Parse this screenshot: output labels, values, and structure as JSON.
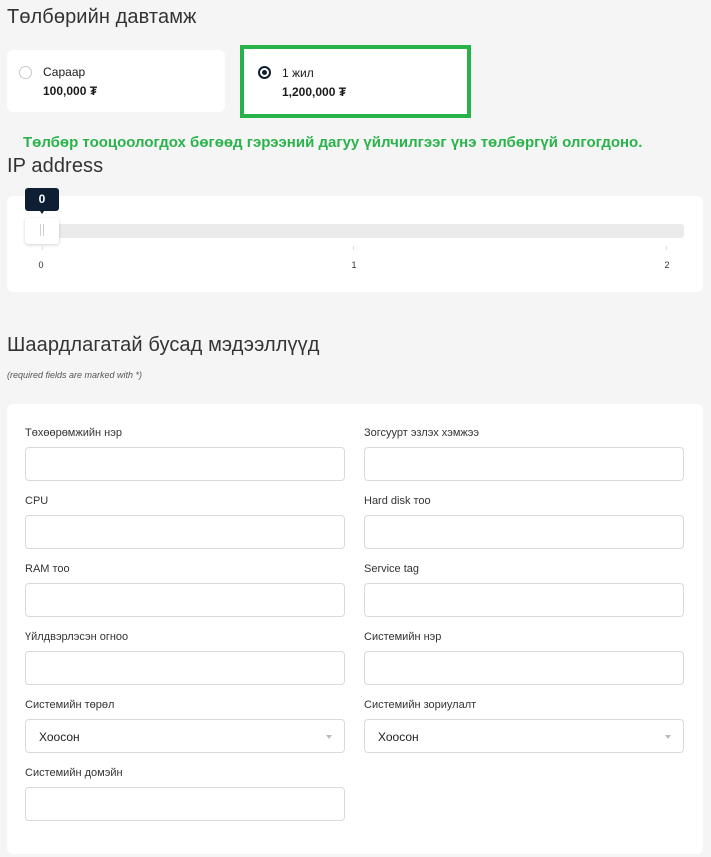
{
  "billing": {
    "title": "Төлбөрийн давтамж",
    "plans": [
      {
        "name": "Сараар",
        "price": "100,000 ₮",
        "selected": false
      },
      {
        "name": "1 жил",
        "price": "1,200,000 ₮",
        "selected": true
      }
    ],
    "notice": "Төлбөр тооцоологдох бөгөөд гэрээний дагуу үйлчилгээг үнэ төлбөргүй олгогдоно."
  },
  "ip": {
    "title": "IP address",
    "slider_value": "0",
    "ticks": [
      "0",
      "1",
      "2"
    ],
    "min": 0,
    "max": 2
  },
  "other": {
    "title": "Шаардлагатай бусад мэдээллүүд",
    "required_note": "(required fields are marked with *)",
    "fields": {
      "device_name": {
        "label": "Төхөөрөмжийн нэр",
        "value": ""
      },
      "mount_size": {
        "label": "Зогсуурт эзлэх хэмжээ",
        "value": ""
      },
      "cpu": {
        "label": "CPU",
        "value": ""
      },
      "hdd_count": {
        "label": "Hard disk тоо",
        "value": ""
      },
      "ram_count": {
        "label": "RAM тоо",
        "value": ""
      },
      "service_tag": {
        "label": "Service tag",
        "value": ""
      },
      "manufactured_date": {
        "label": "Үйлдвэрлэсэн огноо",
        "value": ""
      },
      "system_name": {
        "label": "Системийн нэр",
        "value": ""
      },
      "system_type": {
        "label": "Системийн төрөл",
        "value": "Хоосон"
      },
      "system_purpose": {
        "label": "Системийн зориулалт",
        "value": "Хоосон"
      },
      "system_domain": {
        "label": "Системийн домэйн",
        "value": ""
      }
    }
  },
  "colors": {
    "accent_green": "#28b34a",
    "dark_navy": "#0f1f33",
    "background": "#f5f5f5"
  }
}
